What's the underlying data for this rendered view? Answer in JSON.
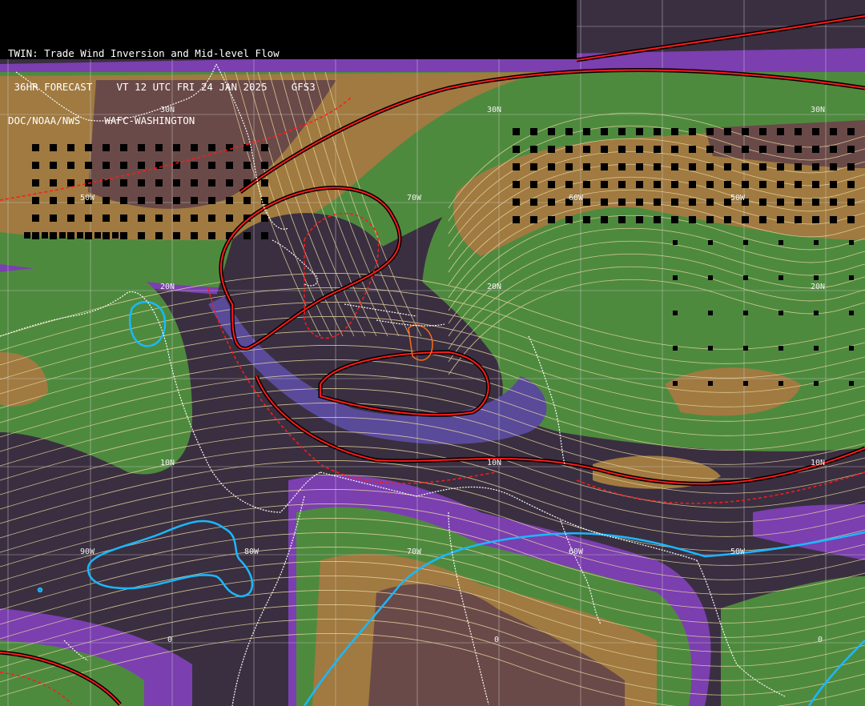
{
  "header": {
    "line1": "TWIN: Trade Wind Inversion and Mid-level Flow",
    "line2": " 36HR FORECAST    VT 12 UTC FRI 24 JAN 2025    GFS3",
    "line3": "DOC/NOAA/NWS    WAFC-WASHINGTON"
  },
  "grid_labels": {
    "lat_30n_a": "30N",
    "lat_30n_b": "30N",
    "lat_30n_c": "30N",
    "lat_20n_a": "20N",
    "lat_20n_b": "20N",
    "lat_20n_c": "20N",
    "lat_10n_a": "10N",
    "lat_10n_b": "10N",
    "lat_10n_c": "10N",
    "lon_90w": "90W",
    "lon_80w": "80W",
    "lon_70w_a": "70W",
    "lon_70w_b": "70W",
    "lon_60w_a": "60W",
    "lon_60w_b": "60W",
    "lon_50w_a": "50W",
    "lon_50w_b": "50W",
    "eq_a": "0",
    "eq_b": "0",
    "eq_c": "0"
  },
  "colors": {
    "inversion_strong": "#6a4a48",
    "inversion_moderate": "#a07a40",
    "inversion_weak": "#4e8a3e",
    "transition": "#5a4a9a",
    "no_inversion": "#3a2f40",
    "purple_band": "#7b3fb0",
    "streamline": "#e8d7a0",
    "trough_line": "#ff1a1a",
    "cyan_contour": "#1ab8ff",
    "coastline": "#ffffff"
  }
}
